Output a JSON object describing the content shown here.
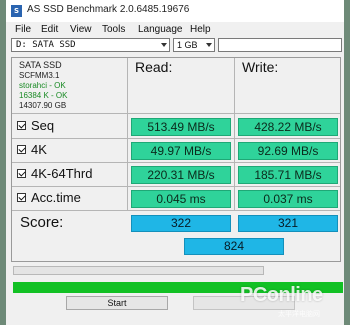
{
  "window": {
    "title": "AS SSD Benchmark 2.0.6485.19676",
    "icon": "as-ssd-app-icon"
  },
  "menu": {
    "items": [
      "File",
      "Edit",
      "View",
      "Tools",
      "Language",
      "Help"
    ]
  },
  "toolbar": {
    "drive": "D: SATA SSD",
    "size": "1 GB",
    "info_value": ""
  },
  "drive_info": {
    "lines": [
      "SATA SSD",
      "SCFMM3.1",
      "storahci - OK",
      "16384 K - OK",
      "14307.90 GB"
    ]
  },
  "columns": {
    "read": "Read:",
    "write": "Write:"
  },
  "rows": [
    {
      "label": "Seq",
      "checked": true,
      "read": "513.49 MB/s",
      "write": "428.22 MB/s"
    },
    {
      "label": "4K",
      "checked": true,
      "read": "49.97 MB/s",
      "write": "92.69 MB/s"
    },
    {
      "label": "4K-64Thrd",
      "checked": true,
      "read": "220.31 MB/s",
      "write": "185.71 MB/s"
    },
    {
      "label": "Acc.time",
      "checked": true,
      "read": "0.045 ms",
      "write": "0.037 ms"
    }
  ],
  "score": {
    "label": "Score:",
    "read": "322",
    "write": "321",
    "total": "824"
  },
  "progress": {
    "fraction": 0,
    "time": ""
  },
  "status": {
    "complete_fraction": 1.0
  },
  "buttons": {
    "start": "Start",
    "abort": ""
  },
  "watermark": {
    "logo": "PConline",
    "sub": "太平洋电脑网"
  },
  "colors": {
    "result_bg": "#2fd39a",
    "score_bg": "#1fb6e6",
    "status_green": "#12c124",
    "info_ok": "#198a24"
  }
}
